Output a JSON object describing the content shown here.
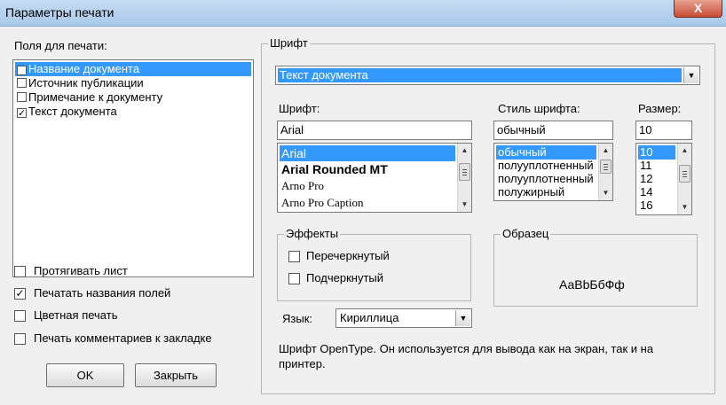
{
  "window": {
    "title": "Параметры печати",
    "close_glyph": "X"
  },
  "fields": {
    "label": "Поля для печати:",
    "items": [
      {
        "label": "Название документа",
        "checked": true,
        "selected": true
      },
      {
        "label": "Источник публикации",
        "checked": false,
        "selected": false
      },
      {
        "label": "Примечание к документу",
        "checked": false,
        "selected": false
      },
      {
        "label": "Текст документа",
        "checked": true,
        "selected": false
      }
    ]
  },
  "options": [
    {
      "label": "Протягивать лист",
      "checked": false
    },
    {
      "label": "Печатать названия полей",
      "checked": true
    },
    {
      "label": "Цветная печать",
      "checked": false
    },
    {
      "label": "Печать комментариев к закладке",
      "checked": false
    }
  ],
  "buttons": {
    "ok": "OK",
    "close": "Закрыть"
  },
  "font_group": {
    "title": "Шрифт",
    "target_value": "Текст документа",
    "font_label": "Шрифт:",
    "font_value": "Arial",
    "font_list": [
      "Arial",
      "Arial Rounded MT",
      "Arno Pro",
      "Arno Pro Caption"
    ],
    "style_label": "Стиль шрифта:",
    "style_value": "обычный",
    "style_list": [
      "обычный",
      "полууплотненный",
      "полууплотненный",
      "полужирный"
    ],
    "size_label": "Размер:",
    "size_value": "10",
    "size_list": [
      "10",
      "11",
      "12",
      "14",
      "16"
    ],
    "effects_title": "Эффекты",
    "strikeout_label": "Перечеркнутый",
    "underline_label": "Подчеркнутый",
    "sample_title": "Образец",
    "sample_text": "АаBbБбФф",
    "language_label": "Язык:",
    "language_value": "Кириллица",
    "description": "Шрифт OpenType. Он используется для вывода как на экран, так и на принтер."
  }
}
